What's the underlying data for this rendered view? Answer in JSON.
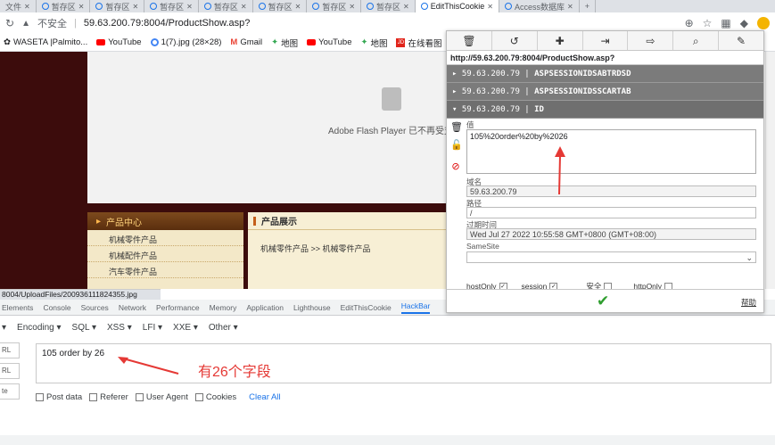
{
  "tabs": [
    {
      "label": "文件"
    },
    {
      "label": "暂存区"
    },
    {
      "label": "暂存区"
    },
    {
      "label": "暂存区"
    },
    {
      "label": "暂存区"
    },
    {
      "label": "暂存区"
    },
    {
      "label": "暂存区"
    },
    {
      "label": "暂存区"
    },
    {
      "label": "EditThisCookie"
    },
    {
      "label": "Access数据库"
    }
  ],
  "address": {
    "insecure": "不安全",
    "url": "59.63.200.79:8004/ProductShow.asp?"
  },
  "bookmarks": [
    {
      "label": "WASETA |Palmito..."
    },
    {
      "label": "YouTube"
    },
    {
      "label": "1(7).jpg (28×28)"
    },
    {
      "label": "Gmail"
    },
    {
      "label": "地图"
    },
    {
      "label": "YouTube"
    },
    {
      "label": "地图"
    },
    {
      "label": "在线看图"
    }
  ],
  "page": {
    "flash_msg": "Adobe Flash Player 已不再受支持",
    "menu_title": "产品中心",
    "menu_items": [
      "机械零件产品",
      "机械配件产品",
      "汽车零件产品"
    ],
    "content_title": "产品展示",
    "breadcrumb": "机械零件产品 >> 机械零件产品"
  },
  "status_url": "8004/UploadFiles/200936111824355.jpg",
  "devtools": {
    "tabs": [
      "Elements",
      "Console",
      "Sources",
      "Network",
      "Performance",
      "Memory",
      "Application",
      "Lighthouse",
      "EditThisCookie",
      "HackBar"
    ]
  },
  "hackbar": {
    "menus": [
      "Encoding ▾",
      "SQL ▾",
      "XSS ▾",
      "LFI ▾",
      "XXE ▾",
      "Other ▾"
    ],
    "side": [
      "RL",
      "RL",
      "te"
    ],
    "query": "105 order by 26",
    "options": [
      "Post data",
      "Referer",
      "User Agent",
      "Cookies"
    ],
    "clear": "Clear All"
  },
  "annotation": "有26个字段",
  "cookie_editor": {
    "tool_icons": [
      "trash-icon",
      "undo-icon",
      "add-icon",
      "import-icon",
      "export-icon",
      "search-icon",
      "wrench-icon"
    ],
    "url": "http://59.63.200.79:8004/ProductShow.asp?",
    "cookies": [
      {
        "domain": "59.63.200.79",
        "name": "ASPSESSIONIDSABTRDSD"
      },
      {
        "domain": "59.63.200.79",
        "name": "ASPSESSIONIDSSCARTAB"
      },
      {
        "domain": "59.63.200.79",
        "name": "ID"
      }
    ],
    "value_label": "值",
    "value": "105%20order%20by%2026",
    "domain_label": "域名",
    "domain": "59.63.200.79",
    "path_label": "路径",
    "path": "/",
    "expiry_label": "过期时间",
    "expiry": "Wed Jul 27 2022 10:55:58 GMT+0800 (GMT+08:00)",
    "samesite_label": "SameSite",
    "flags": [
      "hostOnly",
      "session",
      "安全",
      "httpOnly"
    ],
    "help": "帮助"
  }
}
